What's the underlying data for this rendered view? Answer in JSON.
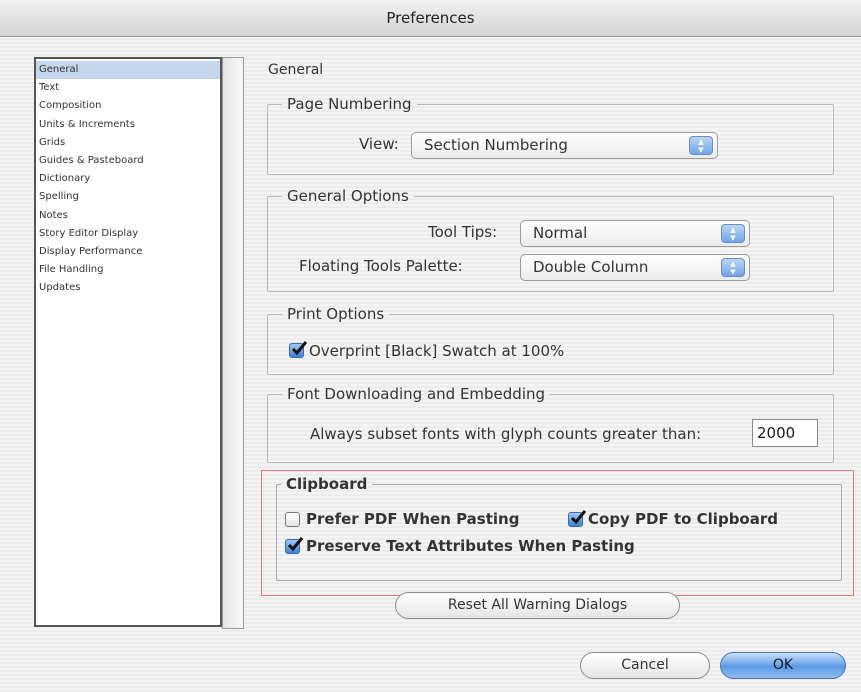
{
  "window": {
    "title": "Preferences"
  },
  "sidebar": {
    "items": [
      {
        "label": "General",
        "selected": true
      },
      {
        "label": "Text"
      },
      {
        "label": "Composition"
      },
      {
        "label": "Units & Increments"
      },
      {
        "label": "Grids"
      },
      {
        "label": "Guides & Pasteboard"
      },
      {
        "label": "Dictionary"
      },
      {
        "label": "Spelling"
      },
      {
        "label": "Notes"
      },
      {
        "label": "Story Editor Display"
      },
      {
        "label": "Display Performance"
      },
      {
        "label": "File Handling"
      },
      {
        "label": "Updates"
      }
    ]
  },
  "main": {
    "title": "General",
    "page_numbering": {
      "legend": "Page Numbering",
      "view_label": "View:",
      "view_value": "Section Numbering"
    },
    "general_options": {
      "legend": "General Options",
      "tooltips_label": "Tool Tips:",
      "tooltips_value": "Normal",
      "floating_label": "Floating Tools Palette:",
      "floating_value": "Double Column"
    },
    "print_options": {
      "legend": "Print Options",
      "overprint_label": "Overprint [Black] Swatch at 100%",
      "overprint_checked": true
    },
    "font_downloading": {
      "legend": "Font Downloading and Embedding",
      "subset_label": "Always subset fonts with glyph counts greater than:",
      "subset_value": "2000"
    },
    "clipboard": {
      "legend": "Clipboard",
      "prefer_pdf_label": "Prefer PDF When Pasting",
      "prefer_pdf_checked": false,
      "copy_pdf_label": "Copy PDF to Clipboard",
      "copy_pdf_checked": true,
      "preserve_text_label": "Preserve Text Attributes When Pasting",
      "preserve_text_checked": true
    },
    "reset_button": "Reset All Warning Dialogs"
  },
  "footer": {
    "cancel": "Cancel",
    "ok": "OK"
  },
  "colors": {
    "highlight_border": "#e07a7a",
    "selection": "#c4d7ec",
    "accent": "#5c9ae6"
  }
}
